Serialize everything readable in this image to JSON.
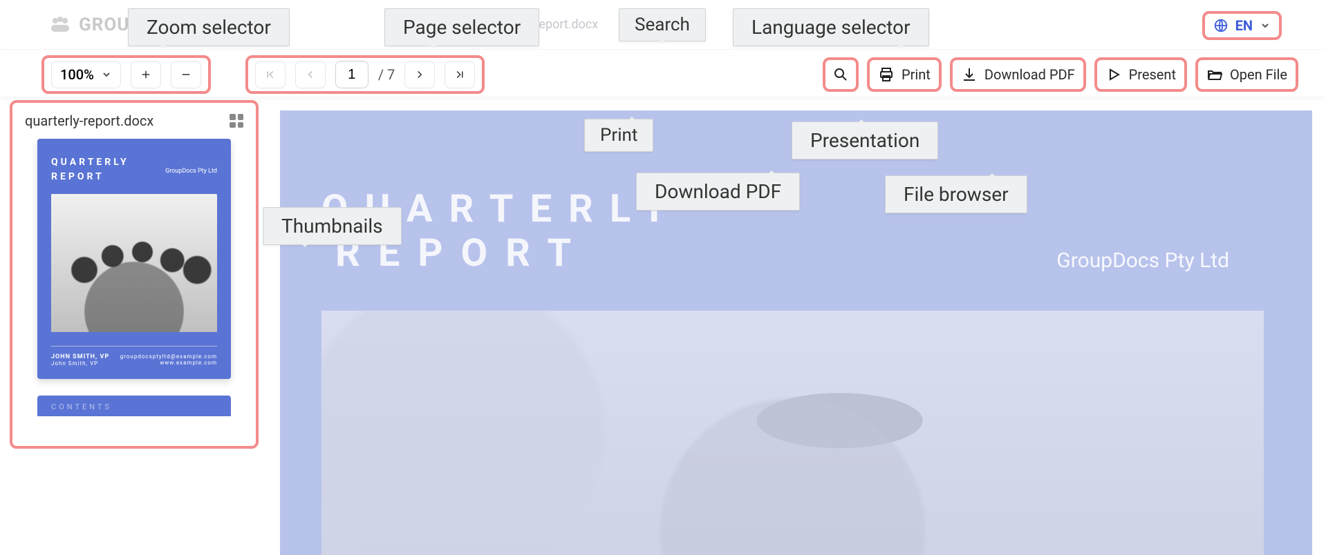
{
  "brand": {
    "name": "GROUPDOCS"
  },
  "breadcrumb": {
    "filename_tail": "y-report.docx"
  },
  "language": {
    "code": "EN"
  },
  "callouts": {
    "zoom": "Zoom selector",
    "pages": "Page selector",
    "search": "Search",
    "language": "Language selector",
    "print": "Print",
    "pdf": "Download PDF",
    "present": "Presentation",
    "files": "File browser",
    "thumbs": "Thumbnails"
  },
  "toolbar": {
    "zoom": {
      "value": "100%"
    },
    "pages": {
      "current": "1",
      "total": "/ 7"
    },
    "print_label": "Print",
    "pdf_label": "Download PDF",
    "present_label": "Present",
    "open_label": "Open File"
  },
  "thumbs": {
    "filename": "quarterly-report.docx",
    "cover": {
      "title_l1": "QUARTERLY",
      "title_l2": "REPORT",
      "company": "GroupDocs Pty Ltd",
      "author_name": "JOHN SMITH, VP",
      "author_sub": "John Smith, VP",
      "email": "groupdocsptyltd@example.com",
      "site": "www.example.com"
    },
    "page2_label": "CONTENTS"
  },
  "doc": {
    "title_l1": "QUARTERLY",
    "title_l2": "REPORT",
    "company": "GroupDocs Pty Ltd"
  }
}
